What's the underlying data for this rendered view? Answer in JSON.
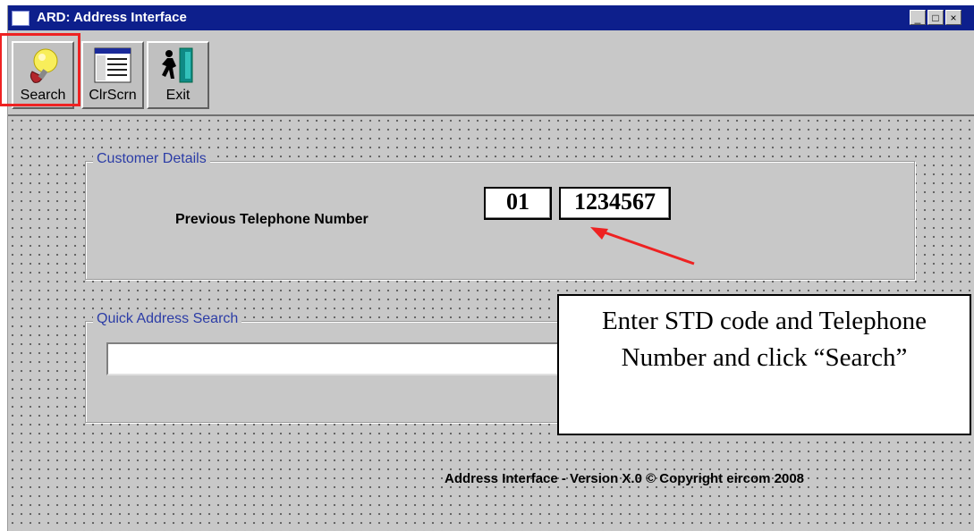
{
  "window": {
    "title": "ARD: Address Interface",
    "controls": {
      "minimize": "_",
      "maximize": "□",
      "close": "×"
    }
  },
  "toolbar": {
    "buttons": [
      {
        "label": "Search",
        "icon": "search-bulb-icon"
      },
      {
        "label": "ClrScrn",
        "icon": "clear-screen-icon"
      },
      {
        "label": "Exit",
        "icon": "exit-door-icon"
      }
    ]
  },
  "customer_details": {
    "legend": "Customer Details",
    "phone_label": "Previous Telephone Number",
    "std_code": "01",
    "phone_number": "1234567"
  },
  "quick_search": {
    "legend": "Quick Address Search",
    "value": ""
  },
  "callout": {
    "text": "Enter STD code and Telephone Number and click “Search”"
  },
  "footer": {
    "text": "Address Interface - Version X.0 © Copyright eircom 2008"
  },
  "colors": {
    "titlebar": "#0d1f8c",
    "highlight": "#ee2222",
    "arrow": "#ee2222",
    "legend_text": "#2b3ca6"
  }
}
